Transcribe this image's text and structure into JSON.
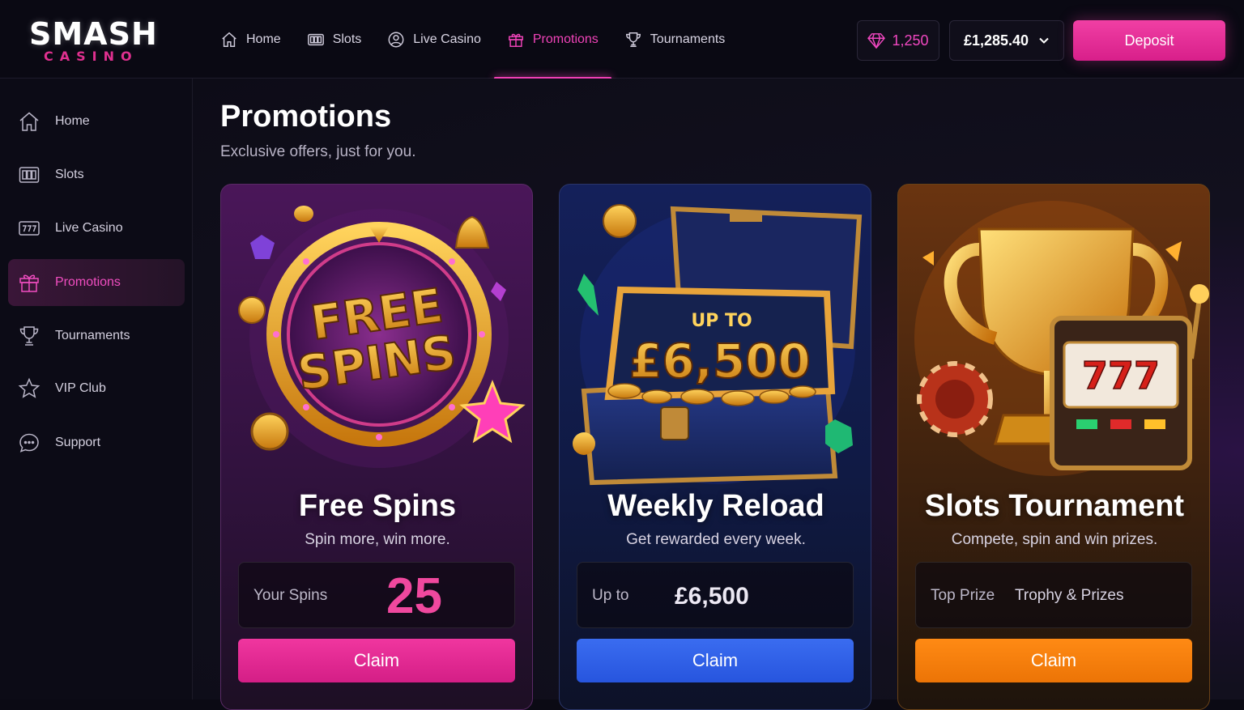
{
  "brand": {
    "name": "SMASH",
    "sub": "CASINO"
  },
  "topnav": [
    {
      "label": "Home",
      "icon": "home-icon"
    },
    {
      "label": "Slots",
      "icon": "slots-icon"
    },
    {
      "label": "Live Casino",
      "icon": "live-casino-icon"
    },
    {
      "label": "Promotions",
      "icon": "gift-icon",
      "active": true
    },
    {
      "label": "Tournaments",
      "icon": "trophy-icon"
    }
  ],
  "header": {
    "gems": "1,250",
    "balance": "£1,285.40",
    "deposit_label": "Deposit"
  },
  "sidebar": [
    {
      "label": "Home",
      "icon": "home-icon"
    },
    {
      "label": "Slots",
      "icon": "slots-icon"
    },
    {
      "label": "Live Casino",
      "icon": "live-casino-icon"
    },
    {
      "label": "Promotions",
      "icon": "gift-icon",
      "active": true
    },
    {
      "label": "Tournaments",
      "icon": "trophy-icon"
    },
    {
      "label": "VIP Club",
      "icon": "star-icon"
    },
    {
      "label": "Support",
      "icon": "chat-icon"
    }
  ],
  "page": {
    "title": "Promotions",
    "subtitle": "Exclusive offers, just for you."
  },
  "cards": [
    {
      "art_line1": "FREE",
      "art_line2": "SPINS",
      "title": "Free Spins",
      "desc": "Spin more, win more.",
      "info_label": "Your Spins",
      "info_value": "25",
      "claim_label": "Claim"
    },
    {
      "art_line1": "UP TO",
      "art_line2": "£6,500",
      "title": "Weekly Reload",
      "desc": "Get rewarded every week.",
      "info_label": "Up to",
      "info_value": "£6,500",
      "claim_label": "Claim"
    },
    {
      "art_line1": "777",
      "title": "Slots Tournament",
      "desc": "Compete, spin and win prizes.",
      "info_label": "Top Prize",
      "info_value": "Trophy & Prizes",
      "claim_label": "Claim"
    }
  ],
  "colors": {
    "accent": "#f03fb4",
    "blue": "#2f5fe8",
    "orange": "#f57c0a",
    "bg": "#0b0a14"
  }
}
